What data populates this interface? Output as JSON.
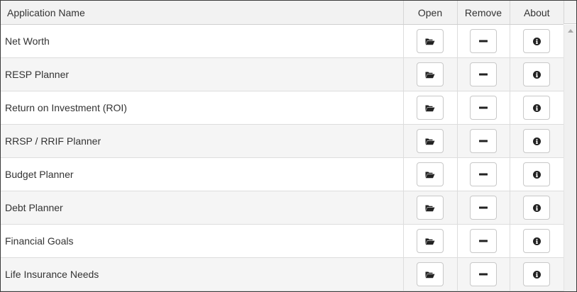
{
  "table": {
    "columns": {
      "name": "Application Name",
      "open": "Open",
      "remove": "Remove",
      "about": "About"
    },
    "rows": [
      {
        "name": "Net Worth"
      },
      {
        "name": "RESP Planner"
      },
      {
        "name": "Return on Investment (ROI)"
      },
      {
        "name": "RRSP / RRIF Planner"
      },
      {
        "name": "Budget Planner"
      },
      {
        "name": "Debt Planner"
      },
      {
        "name": "Financial Goals"
      },
      {
        "name": "Life Insurance Needs"
      }
    ]
  },
  "icons": {
    "open": "folder-open-icon",
    "remove": "minus-icon",
    "about": "info-icon"
  },
  "colors": {
    "border": "#3c3c3c",
    "header_bg": "#f2f2f2",
    "row_alt_bg": "#f5f5f5",
    "icon": "#222222"
  }
}
